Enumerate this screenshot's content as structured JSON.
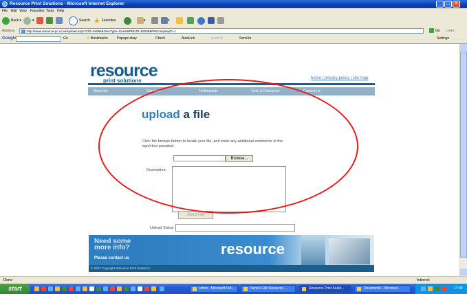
{
  "window": {
    "title": "Resource Print Solutions - Microsoft Internet Explorer"
  },
  "menu": [
    "File",
    "Edit",
    "View",
    "Favorites",
    "Tools",
    "Help"
  ],
  "toolbar": {
    "back": "Back",
    "search": "Search",
    "favorites": "Favorites"
  },
  "address": {
    "label": "Address",
    "url": "http://www.resource-pc.co.uk/upload.aspx?CID=94956&UserType=Guest&PMUID=92006&PMCompanyID=1",
    "go": "Go",
    "links": "Links"
  },
  "google": {
    "label": "Google",
    "go": "Go",
    "bookmarks": "Bookmarks",
    "popups": "Popups okay",
    "check": "Check",
    "autolink": "AutoLink",
    "autofill": "AutoFill",
    "sendto": "Send to",
    "settings": "Settings"
  },
  "page": {
    "logo_main": "resource",
    "logo_sub": "print solutions",
    "top_links": "home | privacy policy | site map",
    "nav": [
      "About Us",
      "Solutions",
      "Testimonials",
      "Tools & Resources",
      "Contact Us"
    ],
    "upload_title_a": "upload",
    "upload_title_b": " a file",
    "instructions": "Click the browse button to locate your file, and enter any additional comments in the input box provided.",
    "browse_label": "Browse...",
    "description_label": "Description:",
    "send_label": "Send File",
    "upload_status_label": "Upload Status",
    "banner_q": "Need some more info?",
    "banner_contact": "Please contact us",
    "banner_word": "resource",
    "footer": "© 2007 Copyright Resource Print Solutions"
  },
  "status": {
    "left": "Done",
    "right": "Internet"
  },
  "taskbar": {
    "start": "start",
    "tasks": [
      "Inbox - Microsoft Out...",
      "Send a File Resource ...",
      "Resource Print Soluti...",
      "Document1 - Microsof..."
    ],
    "clock": "17:09"
  }
}
